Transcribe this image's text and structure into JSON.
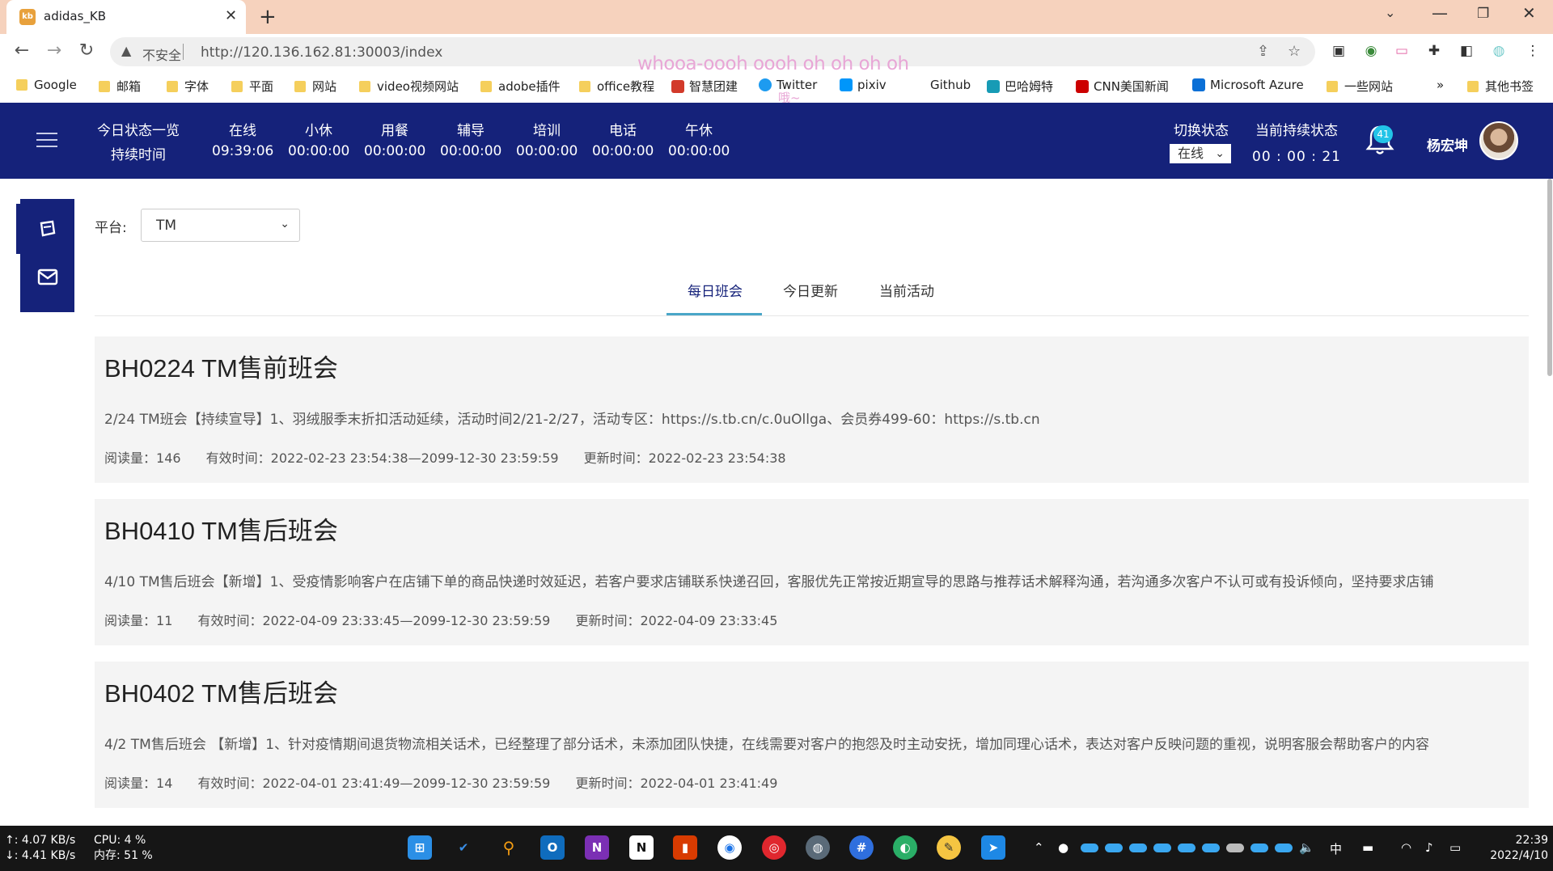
{
  "browser": {
    "tab_title": "adidas_KB",
    "new_tab": "+",
    "insecure_label": "不安全",
    "url": "http://120.136.162.81:30003/index",
    "bookmarks": [
      {
        "label": "Google",
        "kind": "folder"
      },
      {
        "label": "邮箱",
        "kind": "folder"
      },
      {
        "label": "字体",
        "kind": "folder"
      },
      {
        "label": "平面",
        "kind": "folder"
      },
      {
        "label": "网站",
        "kind": "folder"
      },
      {
        "label": "video视频网站",
        "kind": "folder"
      },
      {
        "label": "adobe插件",
        "kind": "folder"
      },
      {
        "label": "office教程",
        "kind": "folder"
      },
      {
        "label": "智慧团建",
        "kind": "site"
      },
      {
        "label": "Twitter",
        "kind": "site"
      },
      {
        "label": "pixiv",
        "kind": "site"
      },
      {
        "label": "Github",
        "kind": "site"
      },
      {
        "label": "巴哈姆特",
        "kind": "site"
      },
      {
        "label": "CNN美国新闻",
        "kind": "site"
      },
      {
        "label": "Microsoft Azure",
        "kind": "site"
      },
      {
        "label": "一些网站",
        "kind": "folder"
      },
      {
        "label": "其他书签",
        "kind": "folder"
      }
    ],
    "overlay_text": "whooa-oooh oooh oh oh oh oh",
    "overlay_text_2": "哦~",
    "more_bookmarks": "»"
  },
  "header": {
    "statuses": [
      {
        "label": "今日状态一览",
        "value": "持续时间"
      },
      {
        "label": "在线",
        "value": "09:39:06"
      },
      {
        "label": "小休",
        "value": "00:00:00"
      },
      {
        "label": "用餐",
        "value": "00:00:00"
      },
      {
        "label": "辅导",
        "value": "00:00:00"
      },
      {
        "label": "培训",
        "value": "00:00:00"
      },
      {
        "label": "电话",
        "value": "00:00:00"
      },
      {
        "label": "午休",
        "value": "00:00:00"
      }
    ],
    "switch_label": "切换状态",
    "switch_value": "在线",
    "current_label": "当前持续状态",
    "current_value": "00 : 00 : 21",
    "notification_count": "41",
    "username": "杨宏坤",
    "accent_color": "#15227a"
  },
  "filters": {
    "platform_label": "平台:",
    "platform_value": "TM"
  },
  "tabs": [
    {
      "label": "每日班会",
      "active": true
    },
    {
      "label": "今日更新",
      "active": false
    },
    {
      "label": "当前活动",
      "active": false
    }
  ],
  "cards": [
    {
      "title": "BH0224 TM售前班会",
      "summary": "2/24 TM班会【持续宣导】1、羽绒服季末折扣活动延续，活动时间2/21-2/27，活动专区：https://s.tb.cn/c.0uOllga、会员券499-60：https://s.tb.cn",
      "reads_label": "阅读量：",
      "reads": "146",
      "valid_label": "有效时间：",
      "valid": "2022-02-23 23:54:38—2099-12-30 23:59:59",
      "updated_label": "更新时间：",
      "updated": "2022-02-23 23:54:38"
    },
    {
      "title": "BH0410 TM售后班会",
      "summary": "4/10 TM售后班会【新增】1、受疫情影响客户在店铺下单的商品快递时效延迟，若客户要求店铺联系快递召回，客服优先正常按近期宣导的思路与推荐话术解释沟通，若沟通多次客户不认可或有投诉倾向，坚持要求店铺",
      "reads_label": "阅读量：",
      "reads": "11",
      "valid_label": "有效时间：",
      "valid": "2022-04-09 23:33:45—2099-12-30 23:59:59",
      "updated_label": "更新时间：",
      "updated": "2022-04-09 23:33:45"
    },
    {
      "title": "BH0402 TM售后班会",
      "summary": "4/2 TM售后班会 【新增】1、针对疫情期间退货物流相关话术，已经整理了部分话术，未添加团队快捷，在线需要对客户的抱怨及时主动安抚，增加同理心话术，表达对客户反映问题的重视，说明客服会帮助客户的内容",
      "reads_label": "阅读量：",
      "reads": "14",
      "valid_label": "有效时间：",
      "valid": "2022-04-01 23:41:49—2099-12-30 23:59:59",
      "updated_label": "更新时间：",
      "updated": "2022-04-01 23:41:49"
    }
  ],
  "taskbar": {
    "net_up": "↑: 4.07 KB/s",
    "net_down": "↓: 4.41 KB/s",
    "cpu": "CPU: 4 %",
    "mem": "内存: 51 %",
    "ime": "中",
    "time": "22:39",
    "date": "2022/4/10"
  }
}
